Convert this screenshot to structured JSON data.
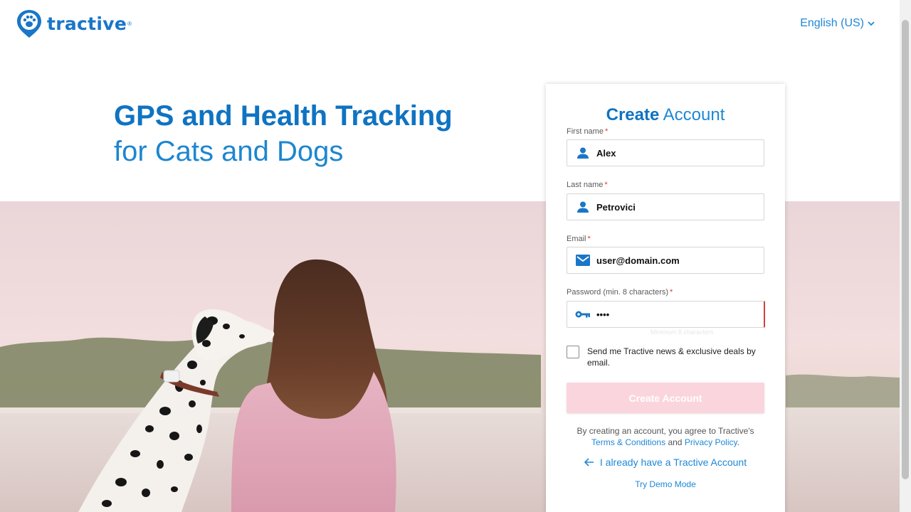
{
  "header": {
    "logo_text": "tractive",
    "logo_reg": "®",
    "language": "English (US)"
  },
  "hero": {
    "headline_strong": "GPS and Health Tracking",
    "headline_light": "for Cats and Dogs"
  },
  "form": {
    "title_strong": "Create",
    "title_light": "Account",
    "required_mark": "*",
    "first_name": {
      "label": "First name",
      "value": "Alex"
    },
    "last_name": {
      "label": "Last name",
      "value": "Petrovici"
    },
    "email": {
      "label": "Email",
      "value": "user@domain.com"
    },
    "password": {
      "label": "Password (min. 8 characters)",
      "value": "••••"
    },
    "password_hint": "Minimum 8 characters",
    "newsletter_label": "Send me Tractive news & exclusive deals by email.",
    "newsletter_checked": false,
    "submit_label": "Create Account",
    "legal_prefix": "By creating an account, you agree to Tractive's",
    "terms_label": "Terms & Conditions",
    "legal_and": "and",
    "privacy_label": "Privacy Policy",
    "legal_suffix": ".",
    "have_account_label": "I already have a Tractive Account",
    "demo_label": "Try Demo Mode"
  },
  "colors": {
    "brand_blue": "#0f73c2",
    "link_blue": "#1e88d6",
    "submit_disabled": "#fbd5dd",
    "error_red": "#d04040"
  },
  "icons": [
    "paw-pin-icon",
    "chevron-down-icon",
    "person-icon",
    "mail-icon",
    "key-icon",
    "arrow-left-icon"
  ]
}
